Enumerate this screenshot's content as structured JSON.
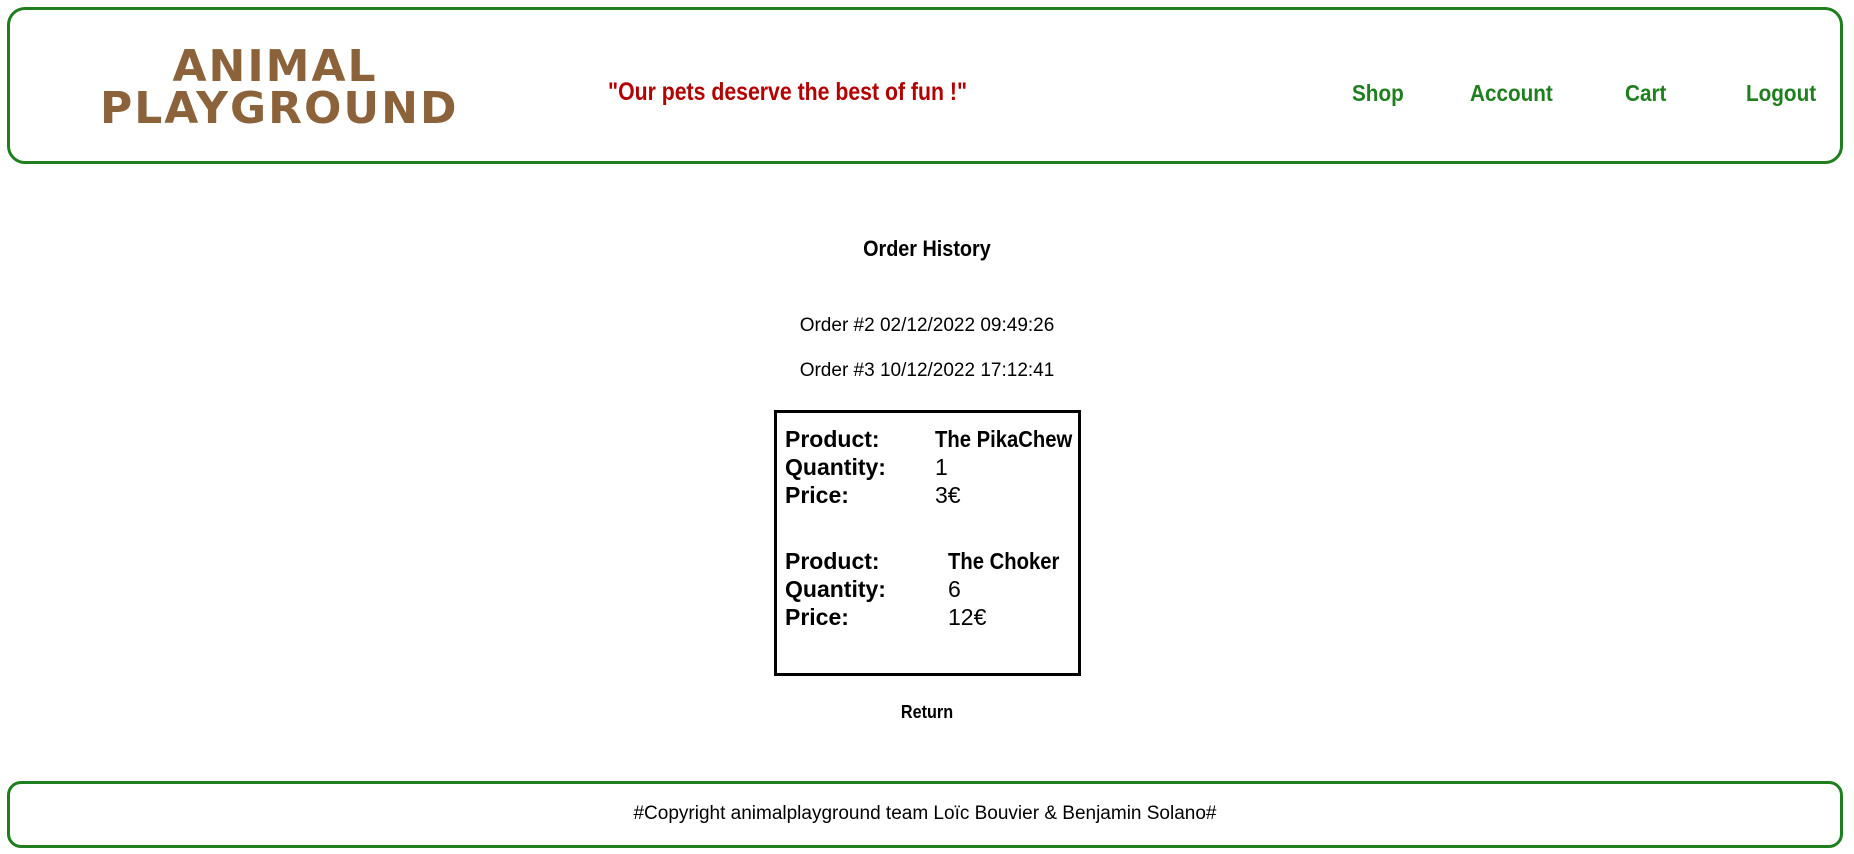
{
  "header": {
    "logo_line1": "ANIMAL",
    "logo_line2": "PLAYGROUND",
    "slogan": "\"Our pets deserve the best of fun !\"",
    "nav": {
      "shop": "Shop",
      "account": "Account",
      "cart": "Cart",
      "logout": "Logout"
    }
  },
  "main": {
    "title": "Order History",
    "orders": [
      "Order #2 02/12/2022 09:49:26",
      "Order #3 10/12/2022 17:12:41"
    ],
    "order_details": {
      "labels": {
        "product": "Product:",
        "quantity": "Quantity:",
        "price": "Price:"
      },
      "items": [
        {
          "product": "The PikaChew",
          "quantity": "1",
          "price": "3€"
        },
        {
          "product": "The Choker",
          "quantity": "6",
          "price": "12€"
        }
      ]
    },
    "return_label": "Return"
  },
  "footer": {
    "copyright": "#Copyright animalplayground team Loïc Bouvier & Benjamin Solano#"
  },
  "colors": {
    "border_green": "#1f7f1f",
    "nav_green": "#1f7f1f",
    "logo_brown": "#8b6239",
    "slogan_red": "#b30000"
  }
}
